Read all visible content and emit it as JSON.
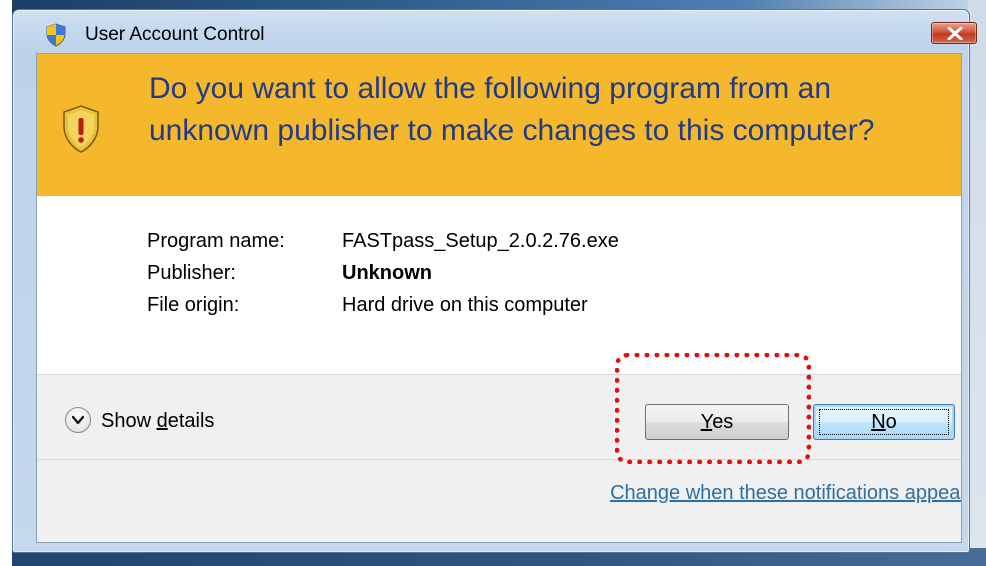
{
  "window": {
    "title": "User Account Control",
    "close_label": "✕"
  },
  "banner": {
    "heading": "Do you want to allow the following program from an unknown publisher to make changes to this computer?",
    "background_color": "#f5b72b",
    "heading_color": "#1f3b8a"
  },
  "details": {
    "rows": [
      {
        "label": "Program name:",
        "value": "FASTpass_Setup_2.0.2.76.exe"
      },
      {
        "label": "Publisher:",
        "value": "Unknown"
      },
      {
        "label": "File origin:",
        "value": "Hard drive on this computer"
      }
    ]
  },
  "actions": {
    "show_details_prefix": "Show ",
    "show_details_accel": "d",
    "show_details_suffix": "etails",
    "yes_accel": "Y",
    "yes_rest": "es",
    "no_accel": "N",
    "no_rest": "o"
  },
  "footer": {
    "link_text": "Change when these notifications appear",
    "link_color": "#2d6ea3"
  },
  "annotation": {
    "color": "#e01111",
    "style": "dotted-rounded-rectangle",
    "target": "yes-button"
  },
  "icons": [
    "uac-shield-icon",
    "warning-shield-icon",
    "close-icon",
    "chevron-down-icon"
  ]
}
